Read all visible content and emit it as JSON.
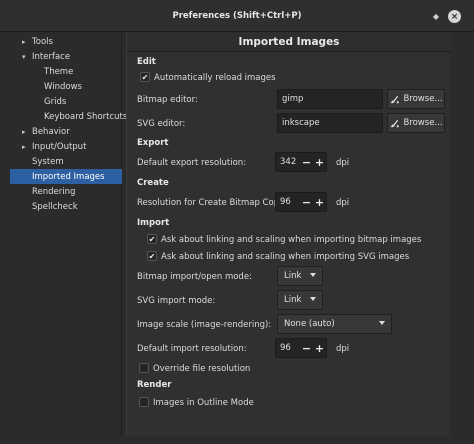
{
  "window": {
    "title": "Preferences (Shift+Ctrl+P)"
  },
  "sidebar": {
    "items": [
      {
        "label": "Tools",
        "arrow": "▸"
      },
      {
        "label": "Interface",
        "arrow": "▾"
      },
      {
        "label": "Theme",
        "arrow": ""
      },
      {
        "label": "Windows",
        "arrow": ""
      },
      {
        "label": "Grids",
        "arrow": ""
      },
      {
        "label": "Keyboard Shortcuts",
        "arrow": ""
      },
      {
        "label": "Behavior",
        "arrow": "▸"
      },
      {
        "label": "Input/Output",
        "arrow": "▸"
      },
      {
        "label": "System",
        "arrow": ""
      },
      {
        "label": "Imported Images",
        "arrow": "",
        "selected": true
      },
      {
        "label": "Rendering",
        "arrow": ""
      },
      {
        "label": "Spellcheck",
        "arrow": ""
      }
    ]
  },
  "content": {
    "title": "Imported Images",
    "edit": {
      "heading": "Edit",
      "auto_reload_label": "Automatically reload images",
      "auto_reload_checked": true,
      "bitmap_label": "Bitmap editor:",
      "bitmap_value": "gimp",
      "svg_label": "SVG editor:",
      "svg_value": "inkscape",
      "browse_label": "Browse..."
    },
    "export": {
      "heading": "Export",
      "resolution_label": "Default export resolution:",
      "resolution_value": "342",
      "unit": "dpi"
    },
    "create": {
      "heading": "Create",
      "resolution_label": "Resolution for Create Bitmap Copy:",
      "resolution_value": "96",
      "unit": "dpi"
    },
    "import": {
      "heading": "Import",
      "ask_bitmap_label": "Ask about linking and scaling when importing bitmap images",
      "ask_bitmap_checked": true,
      "ask_svg_label": "Ask about linking and scaling when importing SVG images",
      "ask_svg_checked": true,
      "bitmap_mode_label": "Bitmap import/open mode:",
      "bitmap_mode_value": "Link",
      "svg_mode_label": "SVG import mode:",
      "svg_mode_value": "Link",
      "scale_label": "Image scale (image-rendering):",
      "scale_value": "None (auto)",
      "resolution_label": "Default import resolution:",
      "resolution_value": "96",
      "unit": "dpi",
      "override_label": "Override file resolution",
      "override_checked": false
    },
    "render": {
      "heading": "Render",
      "outline_label": "Images in Outline Mode",
      "outline_checked": false
    },
    "spin_minus": "−",
    "spin_plus": "+",
    "check_mark": "✔"
  },
  "colors": {
    "selection": "#2d5fa3",
    "background": "#2b2b2b",
    "panel": "#303030"
  }
}
